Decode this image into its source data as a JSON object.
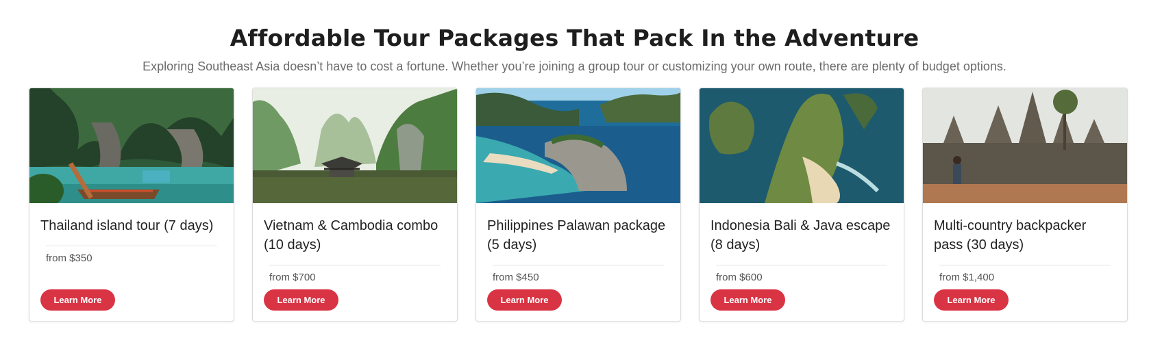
{
  "section": {
    "title": "Affordable Tour Packages That Pack In the Adventure",
    "subtitle": "Exploring Southeast Asia doesn’t have to cost a fortune. Whether you’re joining a group tour or customizing your own route, there are plenty of budget options."
  },
  "cards": [
    {
      "title": "Thailand island tour (7 days)",
      "price": "from $350",
      "button": "Learn More"
    },
    {
      "title": "Vietnam & Cambodia combo (10 days)",
      "price": "from $700",
      "button": "Learn More"
    },
    {
      "title": "Philippines Palawan package (5 days)",
      "price": "from $450",
      "button": "Learn More"
    },
    {
      "title": "Indonesia Bali & Java escape (8 days)",
      "price": "from $600",
      "button": "Learn More"
    },
    {
      "title": "Multi-country backpacker pass (30 days)",
      "price": "from $1,400",
      "button": "Learn More"
    }
  ],
  "colors": {
    "accent": "#d93444",
    "title": "#1e1e1e",
    "subtitle": "#6b6b6b"
  }
}
